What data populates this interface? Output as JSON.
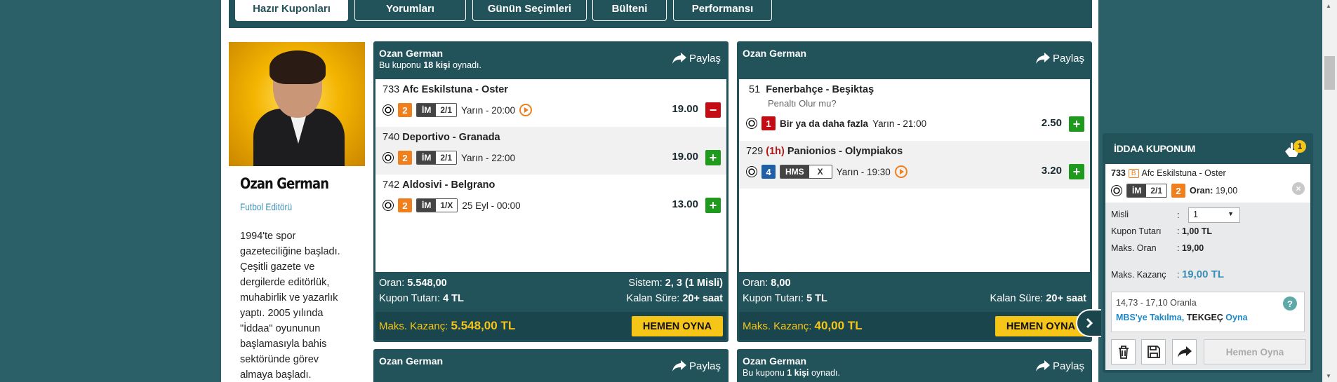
{
  "tabs": [
    "Hazır Kuponları",
    "Yorumları",
    "Günün Seçimleri",
    "Bülteni",
    "Performansı"
  ],
  "editor": {
    "name": "Ozan German",
    "role": "Futbol Editörü",
    "bio_lines": [
      "1994'te spor",
      "gazeteciliğine başladı.",
      "Çeşitli gazete ve",
      "dergilerde editörlük,",
      "muhabirlik ve yazarlık",
      "yaptı. 2005 yılında",
      "\"İddaa\" oyununun",
      "başlamasıyla bahis",
      "sektöründe görev",
      "almaya başladı."
    ]
  },
  "share_label": "Paylaş",
  "coupons": [
    {
      "author": "Ozan German",
      "played_pre": "Bu kuponu ",
      "played_count": "18 kişi",
      "played_post": " oynadı.",
      "matches": [
        {
          "code": "733",
          "extra": "",
          "teams": "Afc Eskilstuna - Oster",
          "note": "",
          "mbs": "2",
          "mbs_color": "o",
          "bet_type": "İM",
          "bet_pick": "2/1",
          "date": "Yarın - 20:00",
          "live": true,
          "odd": "19.00",
          "action": "-"
        },
        {
          "code": "740",
          "extra": "",
          "teams": "Deportivo - Granada",
          "note": "",
          "mbs": "2",
          "mbs_color": "o",
          "bet_type": "İM",
          "bet_pick": "2/1",
          "date": "Yarın - 22:00",
          "live": false,
          "odd": "19.00",
          "action": "+"
        },
        {
          "code": "742",
          "extra": "",
          "teams": "Aldosivi - Belgrano",
          "note": "",
          "mbs": "2",
          "mbs_color": "o",
          "bet_type": "İM",
          "bet_pick": "1/X",
          "date": "25 Eyl - 00:00",
          "live": false,
          "odd": "13.00",
          "action": "+"
        }
      ],
      "oran_label": "Oran:",
      "oran": "5.548,00",
      "sistem_label": "Sistem:",
      "sistem": "2, 3 (1 Misli)",
      "tutar_label": "Kupon Tutarı:",
      "tutar": "4 TL",
      "kalan_label": "Kalan Süre:",
      "kalan": "20+ saat",
      "maks_label": "Maks. Kazanç:",
      "maks": "5.548,00 TL",
      "button": "HEMEN OYNA"
    },
    {
      "author": "Ozan German",
      "matches": [
        {
          "code": "51",
          "extra": "",
          "teams": "Fenerbahçe - Beşiktaş",
          "note": "Penaltı Olur mu?",
          "mbs": "1",
          "mbs_color": "r",
          "bet_text": "Bir ya da daha fazla",
          "date": "Yarın - 21:00",
          "live": false,
          "odd": "2.50",
          "action": "+"
        },
        {
          "code": "729",
          "extra": "(1h)",
          "teams": "Panionios - Olympiakos",
          "note": "",
          "mbs": "4",
          "mbs_color": "b",
          "bet_type": "HMS",
          "bet_pick": "X",
          "date": "Yarın - 19:30",
          "live": true,
          "odd": "3.20",
          "action": "+"
        }
      ],
      "oran_label": "Oran:",
      "oran": "8,00",
      "tutar_label": "Kupon Tutarı:",
      "tutar": "5 TL",
      "kalan_label": "Kalan Süre:",
      "kalan": "20+ saat",
      "maks_label": "Maks. Kazanç:",
      "maks": "40,00 TL",
      "button": "HEMEN OYNA"
    }
  ],
  "bottom_cards": [
    {
      "author": "Ozan German",
      "played": ""
    },
    {
      "author": "Ozan German",
      "played_pre": "Bu kuponu ",
      "played_count": "1 kişi",
      "played_post": " oynadı."
    }
  ],
  "slip": {
    "title": "İDDAA KUPONUM",
    "count": "1",
    "item": {
      "code": "733",
      "badge": "B",
      "teams": "Afc Eskilstuna - Oster",
      "bet_type": "İM",
      "bet_pick": "2/1",
      "mbs": "2",
      "oran_label": "Oran:",
      "oran": "19,00"
    },
    "misli_label": "Misli",
    "misli_value": "1",
    "tutar_label": "Kupon Tutarı",
    "tutar": "1,00 TL",
    "maks_oran_label": "Maks. Oran",
    "maks_oran": "19,00",
    "maks_kazanc_label": "Maks. Kazanç",
    "maks_kazanc": "19,00 TL",
    "range_text": "14,73 - 17,10 Oranla",
    "mbs_link": "MBS'ye Takılma,",
    "tekgec": "TEKGEÇ",
    "oyna": "Oyna",
    "play_button": "Hemen Oyna"
  },
  "colors": {
    "header": "#23535a",
    "accent": "#f5c518",
    "plus": "#1f9a1f",
    "minus": "#c40c14",
    "mbs_orange": "#f07f1d",
    "mbs_blue": "#1e5fa8"
  }
}
